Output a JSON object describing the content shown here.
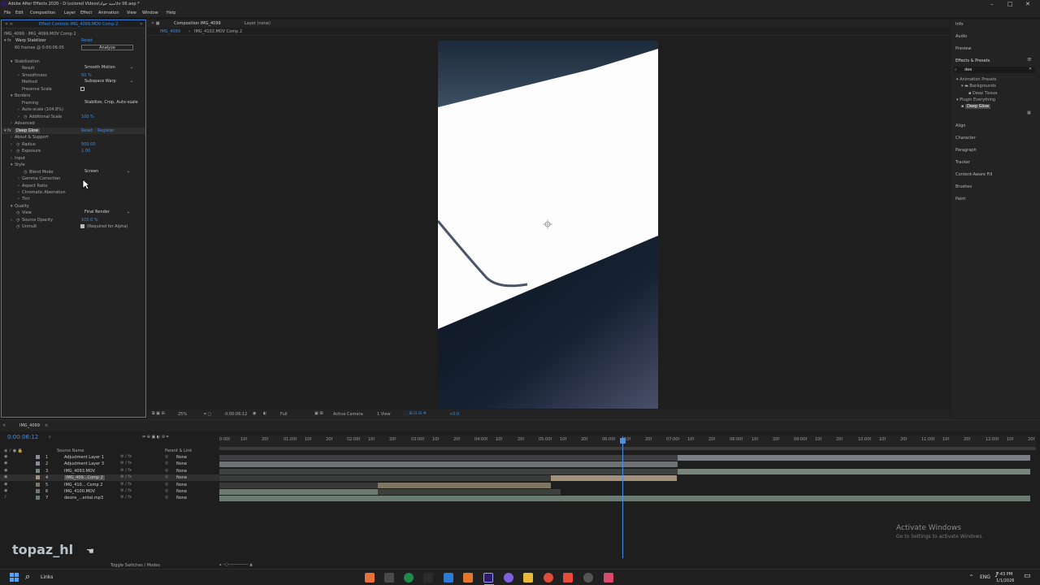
{
  "window": {
    "title": "Adobe After Effects 2020 - D:\\colored Videos\\سید جواد\\tv 06.aep *",
    "minimize": "–",
    "maximize": "□",
    "close": "✕"
  },
  "menu": [
    "File",
    "Edit",
    "Composition",
    "Layer",
    "Effect",
    "Animation",
    "View",
    "Window",
    "Help"
  ],
  "effect_controls": {
    "tab_label": "Effect Controls IMG_4099.MOV Comp 2",
    "path": "IMG_4099 · IMG_4099.MOV Comp 2",
    "warp_stabilizer": {
      "name": "Warp Stabilizer",
      "reset": "Reset",
      "frames": "60 frames @ 0:00:06:05",
      "analyze": "Analyze",
      "stabilization": "Stabilization",
      "result_label": "Result",
      "result_value": "Smooth Motion",
      "smoothness_label": "Smoothness",
      "smoothness_value": "50 %",
      "method_label": "Method",
      "method_value": "Subspace Warp",
      "preserve_scale": "Preserve Scale",
      "borders": "Borders",
      "framing_label": "Framing",
      "framing_value": "Stabilize, Crop, Auto-scale",
      "autoscale": "Auto-scale (104.8%)",
      "additional_scale_label": "Additional Scale",
      "additional_scale_value": "100 %",
      "advanced": "Advanced"
    },
    "deep_glow": {
      "name": "Deep Glow",
      "reset": "Reset",
      "register": "Register",
      "about": "About & Support",
      "radius_label": "Radius",
      "radius_value": "500.00",
      "exposure_label": "Exposure",
      "exposure_value": "1.00",
      "input": "Input",
      "style": "Style",
      "blend_mode_label": "Blend Mode",
      "blend_mode_value": "Screen",
      "gamma": "Gamma Correction",
      "aspect": "Aspect Ratio",
      "chromatic": "Chromatic Aberration",
      "tint": "Tint",
      "quality": "Quality",
      "view_label": "View",
      "view_value": "Final Render",
      "source_opacity_label": "Source Opacity",
      "source_opacity_value": "100.0 %",
      "unmult_label": "Unmult",
      "unmult_value": "(Required for Alpha)"
    }
  },
  "composition": {
    "tab_label": "Composition IMG_4099",
    "layer_tab": "Layer (none)",
    "subtabs": [
      "IMG_4099",
      "IMG_4102.MOV Comp 2"
    ],
    "zoom": "25%",
    "timecode": "0:00:06:12",
    "resolution": "Full",
    "camera": "Active Camera",
    "views": "1 View",
    "exposure": "+0.0"
  },
  "right_panels": {
    "top": [
      "Info",
      "Audio",
      "Preview"
    ],
    "effects_presets": "Effects & Presets",
    "search_value": "dee",
    "tree": [
      "Animation Presets",
      "Backgrounds",
      "Deep Tissue",
      "Plugin Everything",
      "Deep Glow"
    ],
    "bottom": [
      "Align",
      "Character",
      "Paragraph",
      "Tracker",
      "Content-Aware Fill",
      "Brushes",
      "Paint"
    ]
  },
  "timeline": {
    "tab_label": "IMG_4099",
    "timecode": "0:00:06:12",
    "columns": {
      "source": "Source Name",
      "parent": "Parent & Link"
    },
    "ruler": [
      "0:00f",
      "10f",
      "20f",
      "01:00f",
      "10f",
      "20f",
      "02:00f",
      "10f",
      "20f",
      "03:00f",
      "10f",
      "20f",
      "04:00f",
      "10f",
      "20f",
      "05:00f",
      "10f",
      "20f",
      "06:00f",
      "10f",
      "20f",
      "07:00f",
      "10f",
      "20f",
      "08:00f",
      "10f",
      "20f",
      "09:00f",
      "10f",
      "20f",
      "10:00f",
      "10f",
      "20f",
      "11:00f",
      "10f",
      "20f",
      "12:00f",
      "10f",
      "20f"
    ],
    "layers": [
      {
        "num": "1",
        "name": "Adjustment Layer 1",
        "parent": "None"
      },
      {
        "num": "2",
        "name": "Adjustment Layer 3",
        "parent": "None"
      },
      {
        "num": "3",
        "name": "IMG_4093.MOV",
        "parent": "None"
      },
      {
        "num": "4",
        "name": "IMG_409...Comp 2",
        "parent": "None"
      },
      {
        "num": "5",
        "name": "IMG_410... Comp 2",
        "parent": "None"
      },
      {
        "num": "6",
        "name": "IMG_4100.MOV",
        "parent": "None"
      },
      {
        "num": "7",
        "name": "desire_...ental.mp3",
        "parent": "None"
      }
    ],
    "toggle": "Toggle Switches / Modes"
  },
  "watermarks": {
    "activate_title": "Activate Windows",
    "activate_sub": "Go to Settings to activate Windows.",
    "topaz": "topaz_hl"
  },
  "taskbar": {
    "search": "Links",
    "lang": "ENG",
    "time": "7:43 PM",
    "date": "1/1/2026"
  }
}
